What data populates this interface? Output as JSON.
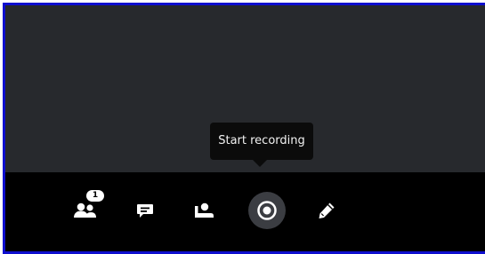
{
  "tooltip": {
    "text": "Start recording"
  },
  "toolbar": {
    "participants": {
      "icon": "participants-icon",
      "badge_count": "1"
    },
    "chat": {
      "icon": "chat-icon"
    },
    "raise_hand": {
      "icon": "raise-hand-icon"
    },
    "record": {
      "icon": "record-icon"
    },
    "whiteboard": {
      "icon": "pencil-icon"
    }
  },
  "colors": {
    "frame_border": "#0e0ecf",
    "stage_bg": "#27292d",
    "toolbar_bg": "#000000",
    "record_button_bg": "#3b3d42",
    "icon": "#ffffff"
  }
}
